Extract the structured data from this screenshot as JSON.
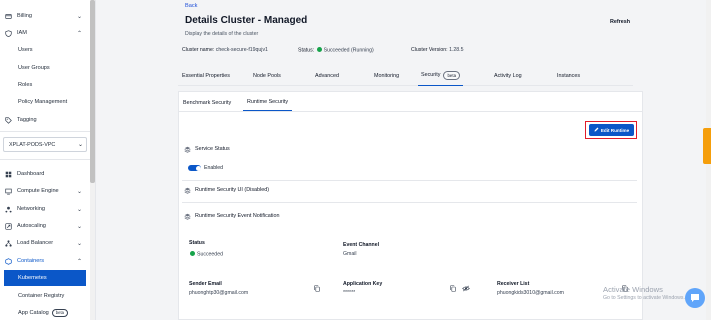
{
  "sidebar": {
    "billing": "Billing",
    "iam": "IAM",
    "iam_items": [
      "Users",
      "User Groups",
      "Roles",
      "Policy Management"
    ],
    "tagging": "Tagging",
    "project": "XPLAT-PODS-VPC",
    "dashboard": "Dashboard",
    "compute_engine": "Compute Engine",
    "networking": "Networking",
    "autoscaling": "Autoscaling",
    "load_balancer": "Load Balancer",
    "containers": "Containers",
    "kubernetes": "Kubernetes",
    "container_registry": "Container Registry",
    "app_catalog": "App Catalog",
    "app_catalog_badge": "beta"
  },
  "header": {
    "back": "Back",
    "title": "Details Cluster - Managed",
    "subtitle": "Display the details of the cluster",
    "refresh": "Refresh",
    "cluster_name_label": "Cluster name:",
    "cluster_name": "check-secure-f19qujv1",
    "status_label": "Status:",
    "status_value": "Succeeded (Running)",
    "version_label": "Cluster Version:",
    "version_value": "1.28.5"
  },
  "tabs": {
    "essential": "Essential Properties",
    "node_pools": "Node Pools",
    "advanced": "Advanced",
    "monitoring": "Monitoring",
    "security": "Security",
    "security_badge": "beta",
    "activity_log": "Activity Log",
    "instances": "Instances"
  },
  "subtabs": {
    "benchmark": "Benchmark Security",
    "runtime": "Runtime Security"
  },
  "runtime": {
    "edit_button": "Edit Runtime",
    "service_status": "Service Status",
    "enabled_label": "Enabled",
    "ui_section": "Runtime Security UI (Disabled)",
    "notification_section": "Runtime Security Event Notification",
    "status_label": "Status",
    "status_value": "Succeeded",
    "event_channel_label": "Event Channel",
    "event_channel_value": "Gmail",
    "sender_email_label": "Sender Email",
    "sender_email_value": "phuonghtp30@gmail.com",
    "app_key_label": "Application Key",
    "app_key_value": "******",
    "receiver_list_label": "Receiver List",
    "receiver_list_value": "phuongkids3010@gmail.com"
  },
  "watermark": {
    "line1": "Activate Windows",
    "line2": "Go to Settings to activate Windows."
  },
  "colors": {
    "primary": "#0b57c8",
    "success": "#16a34a",
    "highlight": "#e11d2a",
    "side_tab": "#f59e0b"
  }
}
